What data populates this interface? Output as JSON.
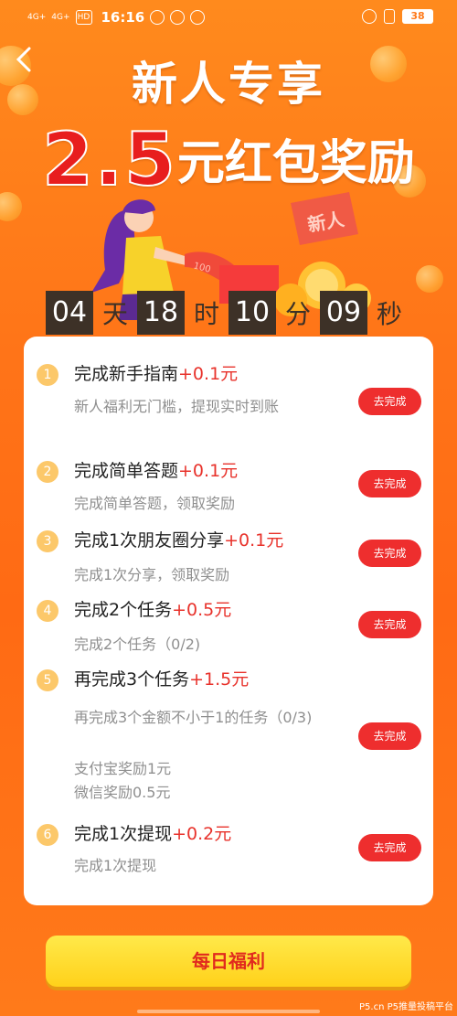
{
  "status_bar": {
    "signal1": "4G+",
    "signal2": "4G+",
    "hd": "HD",
    "time": "16:16",
    "battery": "38"
  },
  "hero": {
    "title": "新人专享",
    "amount": "2.5",
    "amount_suffix": "元红包奖励",
    "ticket_label": "新人",
    "note_label": "100"
  },
  "countdown": {
    "days": "04",
    "days_unit": "天",
    "hours": "18",
    "hours_unit": "时",
    "minutes": "10",
    "minutes_unit": "分",
    "seconds": "09",
    "seconds_unit": "秒"
  },
  "tasks": [
    {
      "num": "1",
      "title": "完成新手指南",
      "reward": "+0.1元",
      "desc": [
        "新人福利无门槛，提现实时到账"
      ],
      "button": "去完成"
    },
    {
      "num": "2",
      "title": "完成简单答题",
      "reward": "+0.1元",
      "desc": [
        "完成简单答题，领取奖励"
      ],
      "button": "去完成"
    },
    {
      "num": "3",
      "title": "完成1次朋友圈分享",
      "reward": "+0.1元",
      "desc": [
        "完成1次分享，领取奖励"
      ],
      "button": "去完成"
    },
    {
      "num": "4",
      "title": "完成2个任务",
      "reward": "+0.5元",
      "desc": [
        "完成2个任务（0/2)"
      ],
      "button": "去完成"
    },
    {
      "num": "5",
      "title": "再完成3个任务",
      "reward": "+1.5元",
      "desc": [
        "再完成3个金额不小于1的任务（0/3)",
        "支付宝奖励1元",
        "微信奖励0.5元"
      ],
      "button": "去完成"
    },
    {
      "num": "6",
      "title": "完成1次提现",
      "reward": "+0.2元",
      "desc": [
        "完成1次提现"
      ],
      "button": "去完成"
    }
  ],
  "bottom_button": "每日福利",
  "watermark": "P5.cn P5推量投稿平台",
  "colors": {
    "accent_red": "#ee2e2e",
    "reward_red": "#e8322b",
    "bg_orange": "#ff7418",
    "gold": "#ffd11a"
  }
}
